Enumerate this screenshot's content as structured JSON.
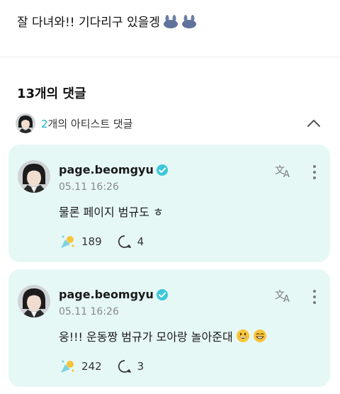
{
  "post": {
    "text": "잘 다녀와!! 기다리구 있을겡",
    "emoji_icons": [
      "bunny-emoji-icon",
      "bunny-emoji-icon"
    ]
  },
  "comments_section": {
    "heading": "13개의 댓글",
    "artist_toggle": {
      "count": "2",
      "label": "개의 아티스트 댓글",
      "expanded": true
    }
  },
  "comments": [
    {
      "username": "page.beomgyu",
      "verified": true,
      "timestamp": "05.11 16:26",
      "body": "물론 페이지 범규도 ㅎ",
      "body_emojis": [],
      "likes": "189",
      "replies": "4"
    },
    {
      "username": "page.beomgyu",
      "verified": true,
      "timestamp": "05.11 16:26",
      "body": "웅!!! 운동짱 범규가 모아랑 놀아준대",
      "body_emojis": [
        "grinning-face-icon",
        "beaming-face-icon"
      ],
      "likes": "242",
      "replies": "3"
    }
  ],
  "colors": {
    "card_bg": "#e6f8f6",
    "accent": "#17b8c6",
    "verified": "#3dc7d9",
    "muted": "#888888"
  }
}
